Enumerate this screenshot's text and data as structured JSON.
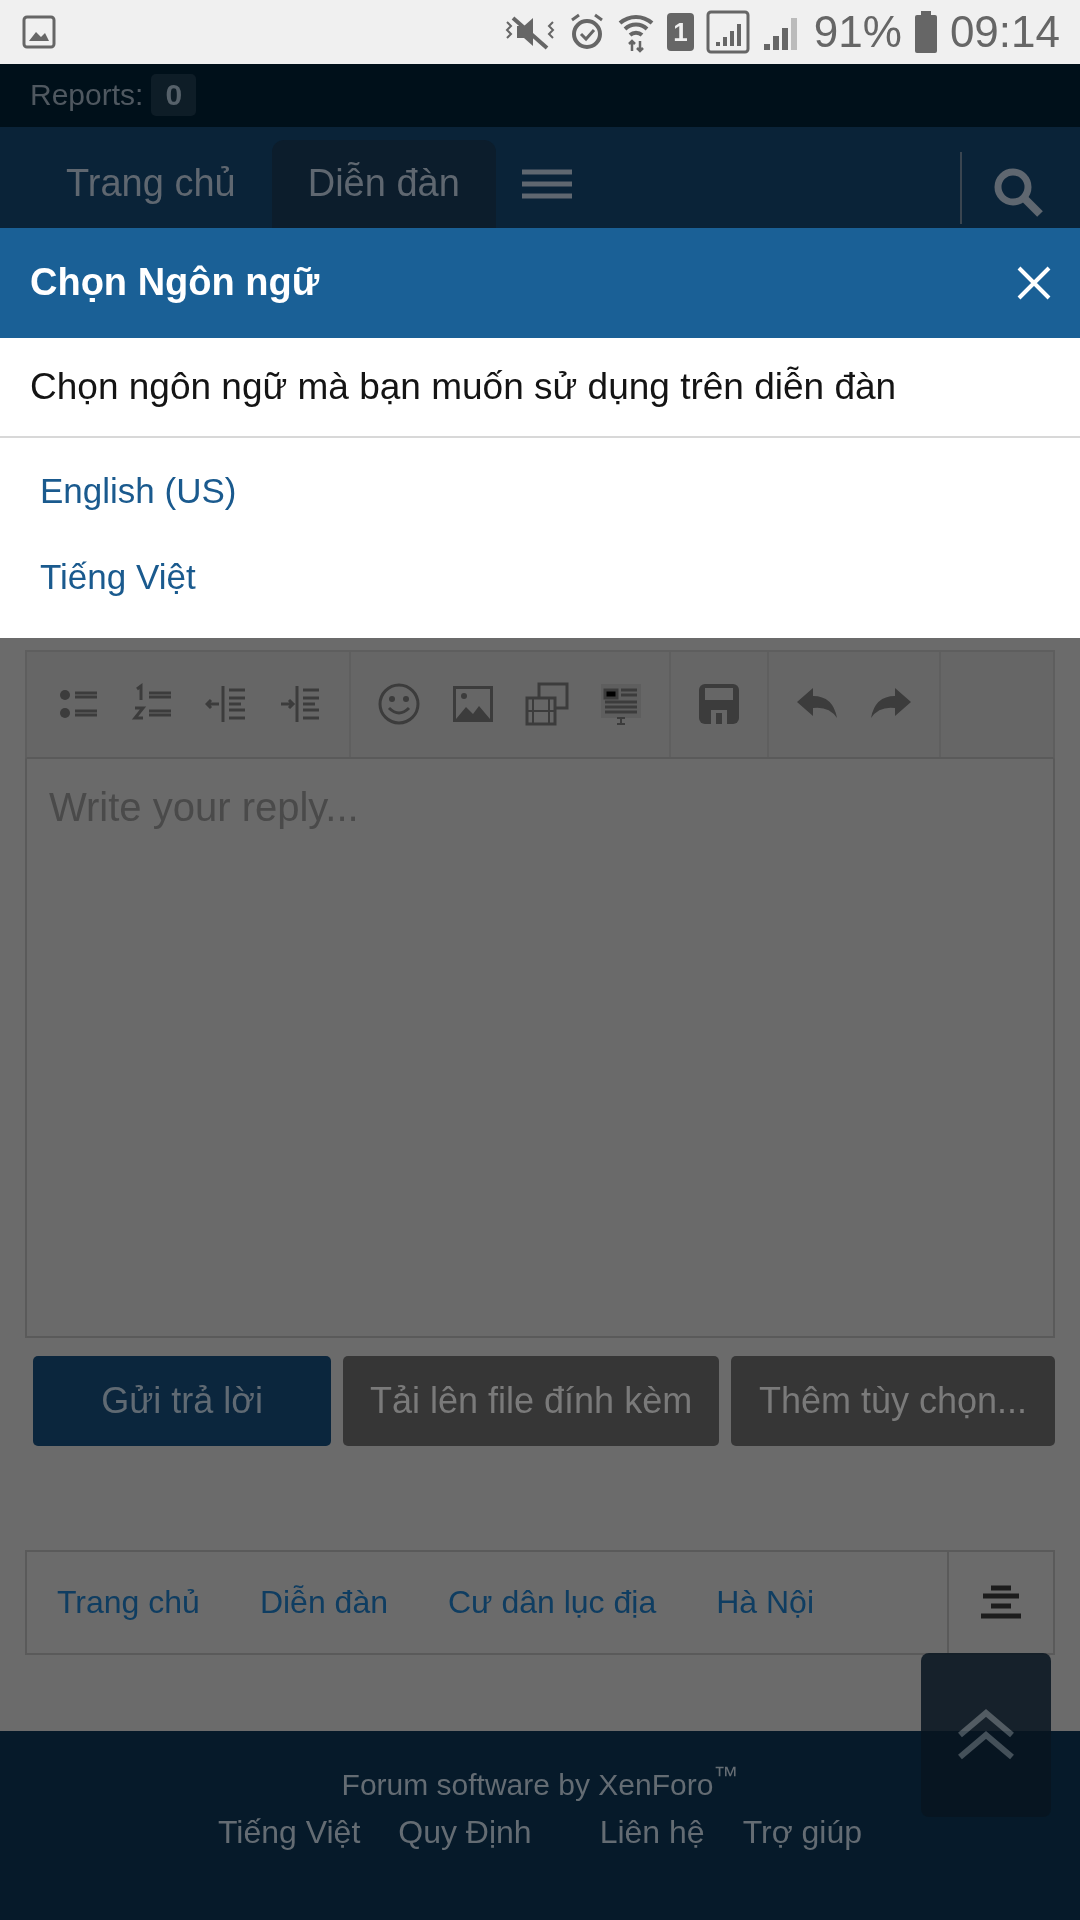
{
  "status_bar": {
    "sim": "1",
    "battery": "91%",
    "time": "09:14"
  },
  "reports": {
    "label": "Reports:",
    "count": "0"
  },
  "nav": {
    "tabs": [
      {
        "label": "Trang chủ",
        "selected": false
      },
      {
        "label": "Diễn đàn",
        "selected": true
      }
    ]
  },
  "dialog": {
    "title": "Chọn Ngôn ngữ",
    "description": "Chọn ngôn ngữ mà bạn muốn sử dụng trên diễn đàn",
    "languages": [
      "English (US)",
      "Tiếng Việt"
    ]
  },
  "editor": {
    "placeholder": "Write your reply..."
  },
  "buttons": [
    {
      "label": "Gửi trả lời",
      "kind": "primary"
    },
    {
      "label": "Tải lên file đính kèm",
      "kind": "secondary"
    },
    {
      "label": "Thêm tùy chọn...",
      "kind": "secondary"
    }
  ],
  "breadcrumb": [
    "Trang chủ",
    "Diễn đàn",
    "Cư dân lục địa",
    "Hà Nội"
  ],
  "footer": {
    "credit": "Forum software by XenForo$^{™}$",
    "links": [
      "Tiếng Việt",
      "Quy Định",
      "Liên hệ",
      "Trợ giúp"
    ]
  }
}
